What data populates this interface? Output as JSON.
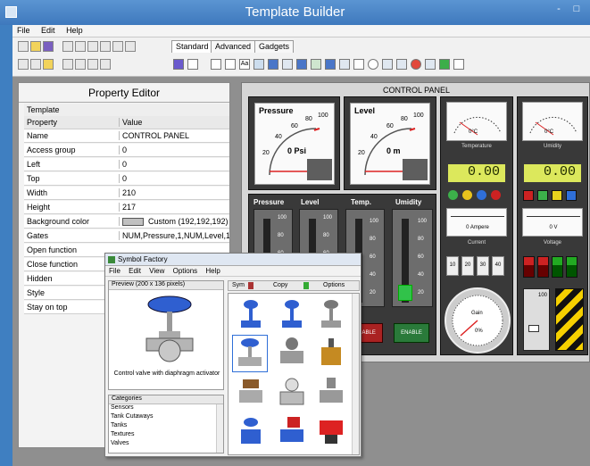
{
  "window": {
    "title": "Template Builder",
    "minimize": "-",
    "maximize": "□"
  },
  "menu": [
    "File",
    "Edit",
    "Help"
  ],
  "toolbar_tabs": [
    "Standard",
    "Advanced",
    "Gadgets"
  ],
  "property_editor": {
    "title": "Property Editor",
    "section": "Template",
    "col_property": "Property",
    "col_value": "Value",
    "rows": [
      {
        "k": "Name",
        "v": "CONTROL PANEL"
      },
      {
        "k": "Access group",
        "v": "0"
      },
      {
        "k": "Left",
        "v": "0"
      },
      {
        "k": "Top",
        "v": "0"
      },
      {
        "k": "Width",
        "v": "210"
      },
      {
        "k": "Height",
        "v": "217"
      },
      {
        "k": "Background color",
        "v": "Custom  (192,192,192)"
      },
      {
        "k": "Gates",
        "v": "NUM,Pressure,1,NUM,Level,1,I"
      },
      {
        "k": "Open function",
        "v": ""
      },
      {
        "k": "Close function",
        "v": ""
      },
      {
        "k": "Hidden",
        "v": ""
      },
      {
        "k": "Style",
        "v": ""
      },
      {
        "k": "Stay on top",
        "v": ""
      }
    ]
  },
  "control_panel": {
    "title": "CONTROL PANEL",
    "gauge_pressure": {
      "label": "Pressure",
      "readout": "0 Psi",
      "ticks": [
        "20",
        "40",
        "60",
        "80",
        "100"
      ]
    },
    "gauge_level": {
      "label": "Level",
      "readout": "0 m",
      "ticks": [
        "20",
        "40",
        "60",
        "80",
        "100"
      ]
    },
    "temperature": {
      "caption": "Temperature",
      "readout": "0°C",
      "lcd": "0.00"
    },
    "umidity": {
      "caption": "Umidity",
      "readout": "0°C",
      "lcd": "0.00"
    },
    "sliders": [
      {
        "label": "Pressure",
        "ticks": [
          "100",
          "80",
          "60",
          "40",
          "20"
        ]
      },
      {
        "label": "Level",
        "ticks": [
          "100",
          "80",
          "60",
          "40",
          "20"
        ]
      },
      {
        "label": "Temp.",
        "ticks": [
          "100",
          "80",
          "60",
          "40",
          "20"
        ]
      },
      {
        "label": "Umidity",
        "ticks": [
          "100",
          "80",
          "60",
          "40",
          "20"
        ]
      }
    ],
    "current": {
      "readout": "0 Ampere",
      "caption": "Current"
    },
    "voltage": {
      "readout": "0 V",
      "caption": "Voltage"
    },
    "gain": {
      "label": "Gain",
      "readout": "0%"
    },
    "enable_label": "ENABLE",
    "digit_buttons": [
      "10",
      "20",
      "30",
      "40"
    ],
    "tick_100": "100"
  },
  "symbol_factory": {
    "title": "Symbol Factory",
    "menu": [
      "File",
      "Edit",
      "View",
      "Options",
      "Help"
    ],
    "preview_label": "Preview (200 x 136 pixels)",
    "preview_caption": "Control valve with diaphragm activator",
    "toolbar": [
      "Sym",
      "Copy",
      "Options"
    ],
    "categories_header": "Categories",
    "categories": [
      "Sensors",
      "Tank Cutaways",
      "Tanks",
      "Textures",
      "Valves"
    ]
  },
  "colors": {
    "accent": "#3f7fc1",
    "lcd": "#dce85c",
    "panel": "#393939",
    "valve_blue": "#2f5fd0"
  }
}
